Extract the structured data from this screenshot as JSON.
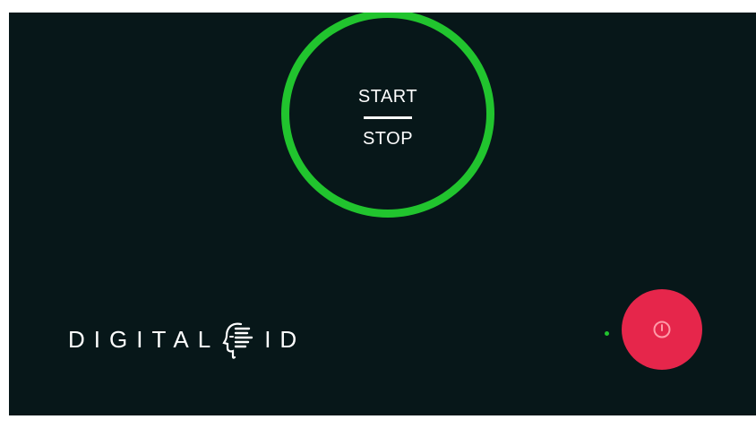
{
  "start_stop": {
    "start_label": "START",
    "stop_label": "STOP"
  },
  "logo": {
    "text_left": "DIGITAL",
    "text_right": "ID",
    "icon": "face-scan-icon"
  },
  "power": {
    "icon": "power-icon"
  },
  "status": {
    "indicator": "status-dot"
  },
  "colors": {
    "background": "#071719",
    "ring": "#21c42e",
    "power_button": "#e6264b",
    "text": "#ffffff"
  }
}
